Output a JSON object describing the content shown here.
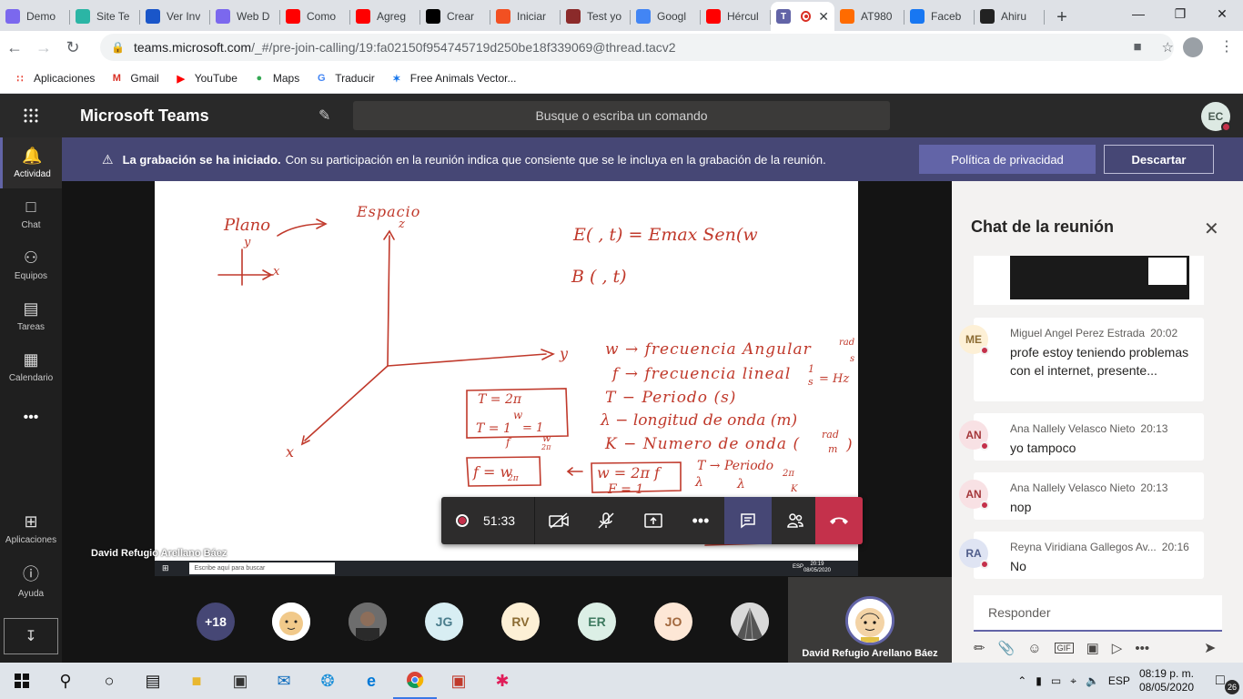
{
  "browser": {
    "tabs": [
      {
        "label": "Demo",
        "icon": "form-icon",
        "color": "#7b68ee"
      },
      {
        "label": "Site Te",
        "icon": "t-icon",
        "color": "#2bb5a5"
      },
      {
        "label": "Ver Inv",
        "icon": "c-icon",
        "color": "#1a56c9"
      },
      {
        "label": "Web D",
        "icon": "form-icon",
        "color": "#7b68ee"
      },
      {
        "label": "Como",
        "icon": "youtube-icon",
        "color": "#ff0000"
      },
      {
        "label": "Agreg",
        "icon": "youtube-icon",
        "color": "#ff0000"
      },
      {
        "label": "Crear",
        "icon": "cursor-icon",
        "color": "#000000"
      },
      {
        "label": "Iniciar",
        "icon": "microsoft-icon",
        "color": "#f25022"
      },
      {
        "label": "Test yo",
        "icon": "shield-icon",
        "color": "#8b2a2a"
      },
      {
        "label": "Googl",
        "icon": "translate-icon",
        "color": "#4285f4"
      },
      {
        "label": "Hércul",
        "icon": "youtube-icon",
        "color": "#ff0000"
      }
    ],
    "active_tab": {
      "icon": "teams-icon",
      "recording": true
    },
    "tabs_after": [
      {
        "label": "AT980",
        "icon": "sf-icon",
        "color": "#ff6b00"
      },
      {
        "label": "Faceb",
        "icon": "facebook-icon",
        "color": "#1877f2"
      },
      {
        "label": "Ahiru",
        "icon": "af-icon",
        "color": "#222222"
      }
    ],
    "url_host": "teams.microsoft.com",
    "url_path": "/_#/pre-join-calling/19:fa02150f954745719d250be18f339069@thread.tacv2",
    "bookmarks": [
      {
        "label": "Aplicaciones",
        "icon": "apps-grid-icon",
        "color": "#e94235"
      },
      {
        "label": "Gmail",
        "icon": "gmail-icon",
        "color": "#d93025"
      },
      {
        "label": "YouTube",
        "icon": "youtube-icon",
        "color": "#ff0000"
      },
      {
        "label": "Maps",
        "icon": "maps-pin-icon",
        "color": "#34a853"
      },
      {
        "label": "Traducir",
        "icon": "translate-icon",
        "color": "#4285f4"
      },
      {
        "label": "Free Animals Vector...",
        "icon": "freepik-icon",
        "color": "#1273eb"
      }
    ]
  },
  "teams": {
    "app_title": "Microsoft Teams",
    "search_placeholder": "Busque o escriba un comando",
    "user_initials": "EC",
    "accent": "#6264a7",
    "rail": [
      {
        "label": "Actividad",
        "icon": "bell-icon"
      },
      {
        "label": "Chat",
        "icon": "chat-icon"
      },
      {
        "label": "Equipos",
        "icon": "teams-group-icon"
      },
      {
        "label": "Tareas",
        "icon": "clipboard-icon"
      },
      {
        "label": "Calendario",
        "icon": "calendar-icon"
      }
    ],
    "rail_more": "•••",
    "rail_bottom": [
      {
        "label": "Aplicaciones",
        "icon": "apps-icon"
      },
      {
        "label": "Ayuda",
        "icon": "help-icon"
      }
    ],
    "banner": {
      "bold": "La grabación se ha iniciado.",
      "text": "Con su participación en la reunión indica que consiente que se le incluya en la grabación de la reunión.",
      "privacy_button": "Política de privacidad",
      "dismiss_button": "Descartar"
    },
    "presenter_name": "David Refugio Arellano Báez",
    "mini_taskbar": {
      "search": "Escribe aquí para buscar",
      "lang": "ESP",
      "time": "20:19",
      "date": "08/05/2020"
    },
    "call": {
      "timer": "51:33"
    },
    "participants": [
      {
        "initials": "+18",
        "bg": "#464775",
        "fg": "#ffffff"
      },
      {
        "initials": "",
        "bg": "#ffffff",
        "fg": "#333333",
        "kind": "image"
      },
      {
        "initials": "",
        "bg": "#7a7a7a",
        "fg": "#ffffff",
        "kind": "image"
      },
      {
        "initials": "JG",
        "bg": "#d8eef3",
        "fg": "#4a7d8c"
      },
      {
        "initials": "RV",
        "bg": "#fdf0d6",
        "fg": "#8c6c33"
      },
      {
        "initials": "ER",
        "bg": "#dcefe6",
        "fg": "#3e7a60"
      },
      {
        "initials": "JO",
        "bg": "#fde7d6",
        "fg": "#a2683e"
      },
      {
        "initials": "",
        "bg": "#cfcfcf",
        "fg": "#333333",
        "kind": "image"
      }
    ],
    "self_name": "David Refugio Arellano Báez"
  },
  "whiteboard": {
    "lines": [
      "Plano",
      "Espacio",
      "z",
      "y",
      "x",
      "y",
      "x",
      "E( , t) = Emax Sen(w",
      "B ( , t)",
      "w → frecuencia Angular",
      "rad",
      "s",
      "f → frecuencia lineal",
      "1",
      "s",
      "= Hz",
      "T − Periodo (s)",
      "λ − longitud de onda (m)",
      "K − Numero de onda (",
      "rad",
      "m",
      ")",
      "T = 2π",
      "w",
      "T = 1",
      "f",
      "= 1",
      "w",
      "2π",
      "f = w",
      "2π",
      "w = 2π f",
      "T → Periodo",
      "λ",
      "λ",
      "2π",
      "K",
      "F = 1"
    ]
  },
  "chat": {
    "title": "Chat de la reunión",
    "messages": [
      {
        "initials": "ME",
        "bg": "#fdf0d6",
        "fg": "#8c6c33",
        "author": "Miguel Angel Perez Estrada",
        "time": "20:02",
        "text": "profe estoy teniendo problemas con el internet, presente..."
      },
      {
        "initials": "AN",
        "bg": "#f8e1e4",
        "fg": "#a4373a",
        "author": "Ana Nallely Velasco Nieto",
        "time": "20:13",
        "text": "yo tampoco"
      },
      {
        "initials": "AN",
        "bg": "#f8e1e4",
        "fg": "#a4373a",
        "author": "Ana Nallely Velasco Nieto",
        "time": "20:13",
        "text": "nop"
      },
      {
        "initials": "RA",
        "bg": "#dfe4f3",
        "fg": "#4f5c8a",
        "author": "Reyna Viridiana Gallegos Av...",
        "time": "20:16",
        "text": "No"
      }
    ],
    "reply_placeholder": "Responder"
  },
  "windows": {
    "lang": "ESP",
    "time": "08:19 p. m.",
    "date": "08/05/2020",
    "notifications": "26"
  }
}
